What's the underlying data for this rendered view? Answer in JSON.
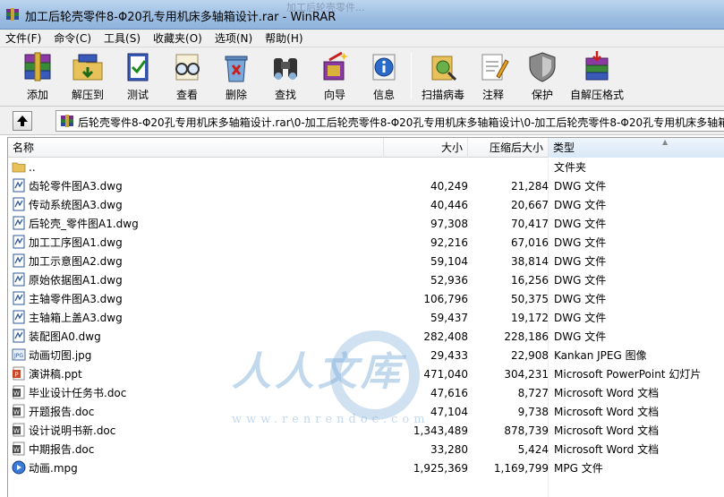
{
  "window": {
    "title": "加工后轮壳零件8-Φ20孔专用机床多轴箱设计.rar - WinRAR",
    "background_ghost_text": "加工后轮壳零件..."
  },
  "menu": [
    {
      "label": "文件(F)"
    },
    {
      "label": "命令(C)"
    },
    {
      "label": "工具(S)"
    },
    {
      "label": "收藏夹(O)"
    },
    {
      "label": "选项(N)"
    },
    {
      "label": "帮助(H)"
    }
  ],
  "toolbar": [
    {
      "label": "添加",
      "icon": "books-add-icon"
    },
    {
      "label": "解压到",
      "icon": "folder-extract-icon"
    },
    {
      "label": "测试",
      "icon": "test-book-icon"
    },
    {
      "label": "查看",
      "icon": "glasses-view-icon"
    },
    {
      "label": "删除",
      "icon": "recycle-delete-icon"
    },
    {
      "label": "查找",
      "icon": "binoculars-find-icon"
    },
    {
      "label": "向导",
      "icon": "wizard-wand-icon"
    },
    {
      "label": "信息",
      "icon": "info-icon"
    },
    {
      "label": "扫描病毒",
      "icon": "virus-scan-icon"
    },
    {
      "label": "注释",
      "icon": "comment-icon"
    },
    {
      "label": "保护",
      "icon": "shield-protect-icon"
    },
    {
      "label": "自解压格式",
      "icon": "sfx-box-icon"
    }
  ],
  "path": {
    "text": "后轮壳零件8-Φ20孔专用机床多轴箱设计.rar\\0-加工后轮壳零件8-Φ20孔专用机床多轴箱设计\\0-加工后轮壳零件8-Φ20孔专用机床多轴箱"
  },
  "columns": {
    "name": "名称",
    "size": "大小",
    "packed": "压缩后大小",
    "type": "类型"
  },
  "files": [
    {
      "name": "..",
      "size": "",
      "packed": "",
      "type": "文件夹",
      "icon": "folder-icon"
    },
    {
      "name": "齿轮零件图A3.dwg",
      "size": "40,249",
      "packed": "21,284",
      "type": "DWG 文件",
      "icon": "dwg-file-icon"
    },
    {
      "name": "传动系统图A3.dwg",
      "size": "40,446",
      "packed": "20,667",
      "type": "DWG 文件",
      "icon": "dwg-file-icon"
    },
    {
      "name": "后轮壳_零件图A1.dwg",
      "size": "97,308",
      "packed": "70,417",
      "type": "DWG 文件",
      "icon": "dwg-file-icon"
    },
    {
      "name": "加工工序图A1.dwg",
      "size": "92,216",
      "packed": "67,016",
      "type": "DWG 文件",
      "icon": "dwg-file-icon"
    },
    {
      "name": "加工示意图A2.dwg",
      "size": "59,104",
      "packed": "38,814",
      "type": "DWG 文件",
      "icon": "dwg-file-icon"
    },
    {
      "name": "原始依据图A1.dwg",
      "size": "52,936",
      "packed": "16,256",
      "type": "DWG 文件",
      "icon": "dwg-file-icon"
    },
    {
      "name": "主轴零件图A3.dwg",
      "size": "106,796",
      "packed": "50,375",
      "type": "DWG 文件",
      "icon": "dwg-file-icon"
    },
    {
      "name": "主轴箱上盖A3.dwg",
      "size": "59,437",
      "packed": "19,172",
      "type": "DWG 文件",
      "icon": "dwg-file-icon"
    },
    {
      "name": "装配图A0.dwg",
      "size": "282,408",
      "packed": "228,186",
      "type": "DWG 文件",
      "icon": "dwg-file-icon"
    },
    {
      "name": "动画切图.jpg",
      "size": "29,433",
      "packed": "22,908",
      "type": "Kankan JPEG 图像",
      "icon": "jpeg-file-icon"
    },
    {
      "name": "演讲稿.ppt",
      "size": "471,040",
      "packed": "304,231",
      "type": "Microsoft PowerPoint 幻灯片",
      "icon": "ppt-file-icon"
    },
    {
      "name": "毕业设计任务书.doc",
      "size": "47,616",
      "packed": "8,727",
      "type": "Microsoft Word 文档",
      "icon": "doc-file-icon"
    },
    {
      "name": "开题报告.doc",
      "size": "47,104",
      "packed": "9,738",
      "type": "Microsoft Word 文档",
      "icon": "doc-file-icon"
    },
    {
      "name": "设计说明书新.doc",
      "size": "1,343,489",
      "packed": "878,739",
      "type": "Microsoft Word 文档",
      "icon": "doc-file-icon"
    },
    {
      "name": "中期报告.doc",
      "size": "33,280",
      "packed": "5,424",
      "type": "Microsoft Word 文档",
      "icon": "doc-file-icon"
    },
    {
      "name": "动画.mpg",
      "size": "1,925,369",
      "packed": "1,169,799",
      "type": "MPG 文件",
      "icon": "mpg-file-icon"
    }
  ],
  "watermark": {
    "text": "人人文库",
    "url": "www.renrendoc.com"
  },
  "colors": {
    "titlebar": "#9cbde2",
    "watermark": "#78aad7",
    "doc_blue": "#2b5797",
    "ppt_red": "#c8482b"
  }
}
